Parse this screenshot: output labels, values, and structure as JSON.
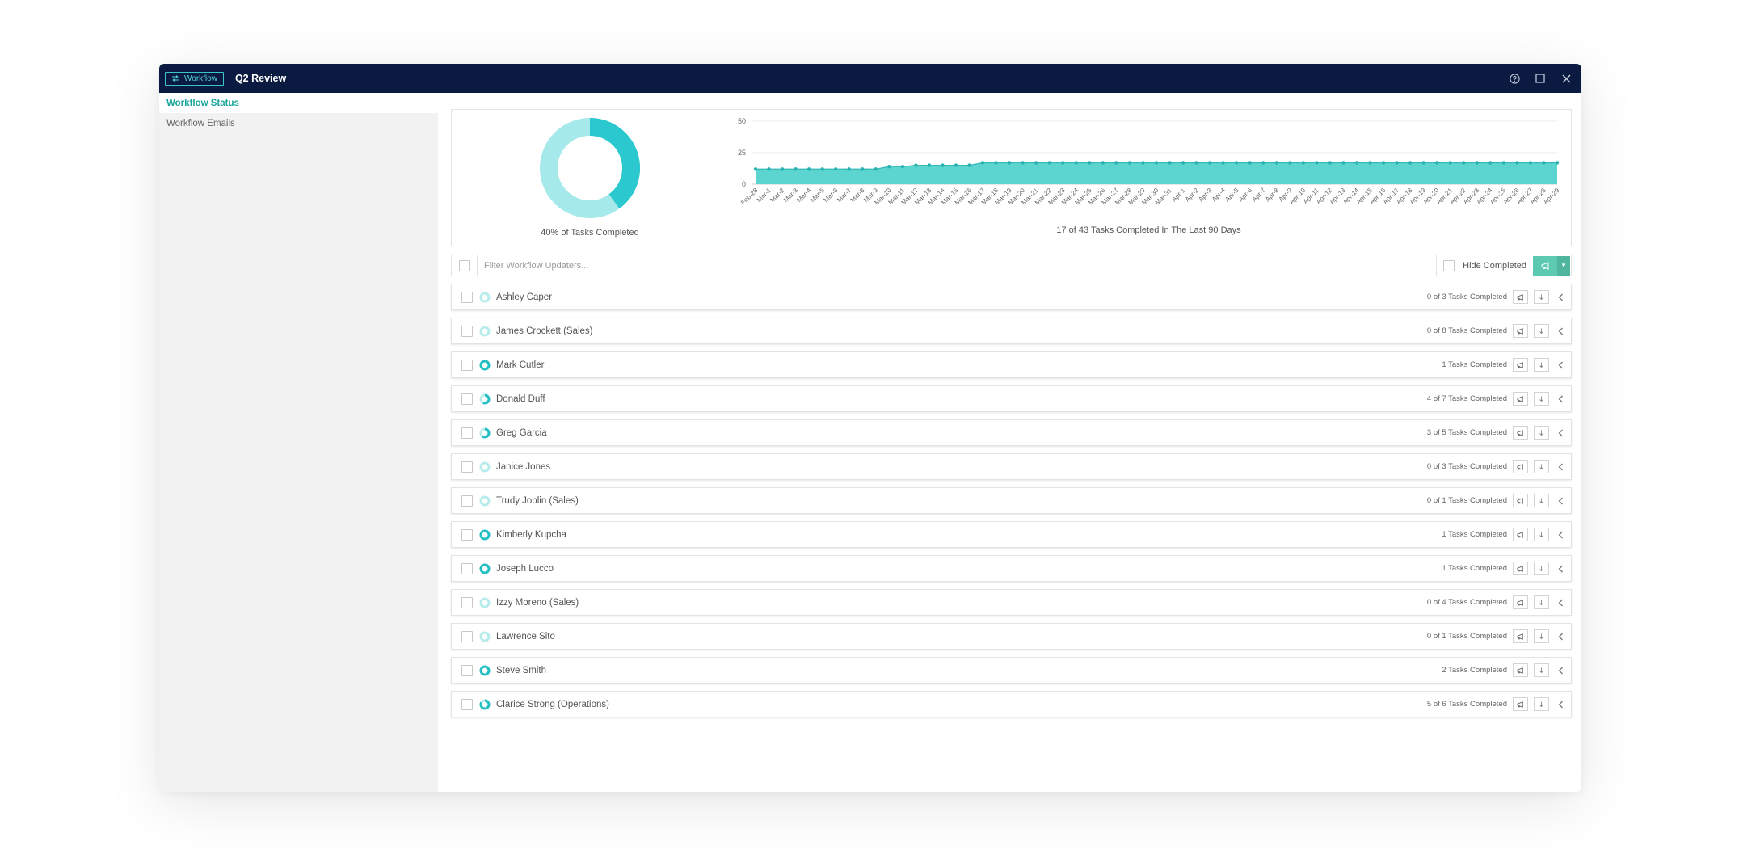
{
  "window": {
    "badge_label": "Workflow",
    "title": "Q2 Review",
    "icons": [
      "help-icon",
      "maximize-icon",
      "close-icon"
    ]
  },
  "sidebar": {
    "items": [
      {
        "label": "Workflow Status",
        "active": true
      },
      {
        "label": "Workflow Emails",
        "active": false
      }
    ]
  },
  "stats": {
    "donut_caption": "40% of Tasks Completed",
    "donut_completed_fraction": 0.4,
    "chart_caption": "17 of 43 Tasks Completed In The Last 90 Days"
  },
  "chart_data": {
    "type": "area",
    "title": "",
    "xlabel": "",
    "ylabel": "",
    "ylim": [
      0,
      50
    ],
    "yticks": [
      0,
      25,
      50
    ],
    "categories": [
      "Feb-28",
      "Mar-1",
      "Mar-2",
      "Mar-3",
      "Mar-4",
      "Mar-5",
      "Mar-6",
      "Mar-7",
      "Mar-8",
      "Mar-9",
      "Mar-10",
      "Mar-11",
      "Mar-12",
      "Mar-13",
      "Mar-14",
      "Mar-15",
      "Mar-16",
      "Mar-17",
      "Mar-18",
      "Mar-19",
      "Mar-20",
      "Mar-21",
      "Mar-22",
      "Mar-23",
      "Mar-24",
      "Mar-25",
      "Mar-26",
      "Mar-27",
      "Mar-28",
      "Mar-29",
      "Mar-30",
      "Mar-31",
      "Apr-1",
      "Apr-2",
      "Apr-3",
      "Apr-4",
      "Apr-5",
      "Apr-6",
      "Apr-7",
      "Apr-8",
      "Apr-9",
      "Apr-10",
      "Apr-11",
      "Apr-12",
      "Apr-13",
      "Apr-14",
      "Apr-15",
      "Apr-16",
      "Apr-17",
      "Apr-18",
      "Apr-19",
      "Apr-20",
      "Apr-21",
      "Apr-22",
      "Apr-23",
      "Apr-24",
      "Apr-25",
      "Apr-26",
      "Apr-27",
      "Apr-28",
      "Apr-29"
    ],
    "values": [
      12,
      12,
      12,
      12,
      12,
      12,
      12,
      12,
      12,
      12,
      14,
      14,
      15,
      15,
      15,
      15,
      15,
      17,
      17,
      17,
      17,
      17,
      17,
      17,
      17,
      17,
      17,
      17,
      17,
      17,
      17,
      17,
      17,
      17,
      17,
      17,
      17,
      17,
      17,
      17,
      17,
      17,
      17,
      17,
      17,
      17,
      17,
      17,
      17,
      17,
      17,
      17,
      17,
      17,
      17,
      17,
      17,
      17,
      17,
      17,
      17
    ],
    "grid": true,
    "legend": "none",
    "color": "#5cd4d0"
  },
  "filter": {
    "placeholder": "Filter Workflow Updaters...",
    "hide_completed_label": "Hide Completed"
  },
  "users": [
    {
      "name": "Ashley Caper",
      "status": "Not started",
      "progress": 0.0,
      "tasks": "0 of 3 Tasks Completed"
    },
    {
      "name": "James Crockett (Sales)",
      "status": "Not started",
      "progress": 0.0,
      "tasks": "0 of 8 Tasks Completed"
    },
    {
      "name": "Mark Cutler",
      "status": "Done",
      "progress": 1.0,
      "tasks": "1 Tasks Completed"
    },
    {
      "name": "Donald Duff",
      "status": "In progress",
      "progress": 0.571,
      "tasks": "4 of 7 Tasks Completed"
    },
    {
      "name": "Greg Garcia",
      "status": "In progress",
      "progress": 0.6,
      "tasks": "3 of 5 Tasks Completed"
    },
    {
      "name": "Janice Jones",
      "status": "Not started",
      "progress": 0.0,
      "tasks": "0 of 3 Tasks Completed"
    },
    {
      "name": "Trudy Joplin (Sales)",
      "status": "Not started",
      "progress": 0.0,
      "tasks": "0 of 1 Tasks Completed"
    },
    {
      "name": "Kimberly Kupcha",
      "status": "Done",
      "progress": 1.0,
      "tasks": "1 Tasks Completed"
    },
    {
      "name": "Joseph Lucco",
      "status": "Done",
      "progress": 1.0,
      "tasks": "1 Tasks Completed"
    },
    {
      "name": "Izzy Moreno (Sales)",
      "status": "Not started",
      "progress": 0.0,
      "tasks": "0 of 4 Tasks Completed"
    },
    {
      "name": "Lawrence Sito",
      "status": "Not started",
      "progress": 0.0,
      "tasks": "0 of 1 Tasks Completed"
    },
    {
      "name": "Steve Smith",
      "status": "Done",
      "progress": 1.0,
      "tasks": "2 Tasks Completed"
    },
    {
      "name": "Clarice Strong (Operations)",
      "status": "In progress",
      "progress": 0.833,
      "tasks": "5 of 6 Tasks Completed"
    }
  ],
  "colors": {
    "header_bg": "#0b1a40",
    "accent_teal": "#1aa59a",
    "donut_done": "#2bc9cf",
    "donut_remaining": "#a6e9ea",
    "chart_fill": "#5cd4d0",
    "send_button": "#5cc9b0"
  }
}
